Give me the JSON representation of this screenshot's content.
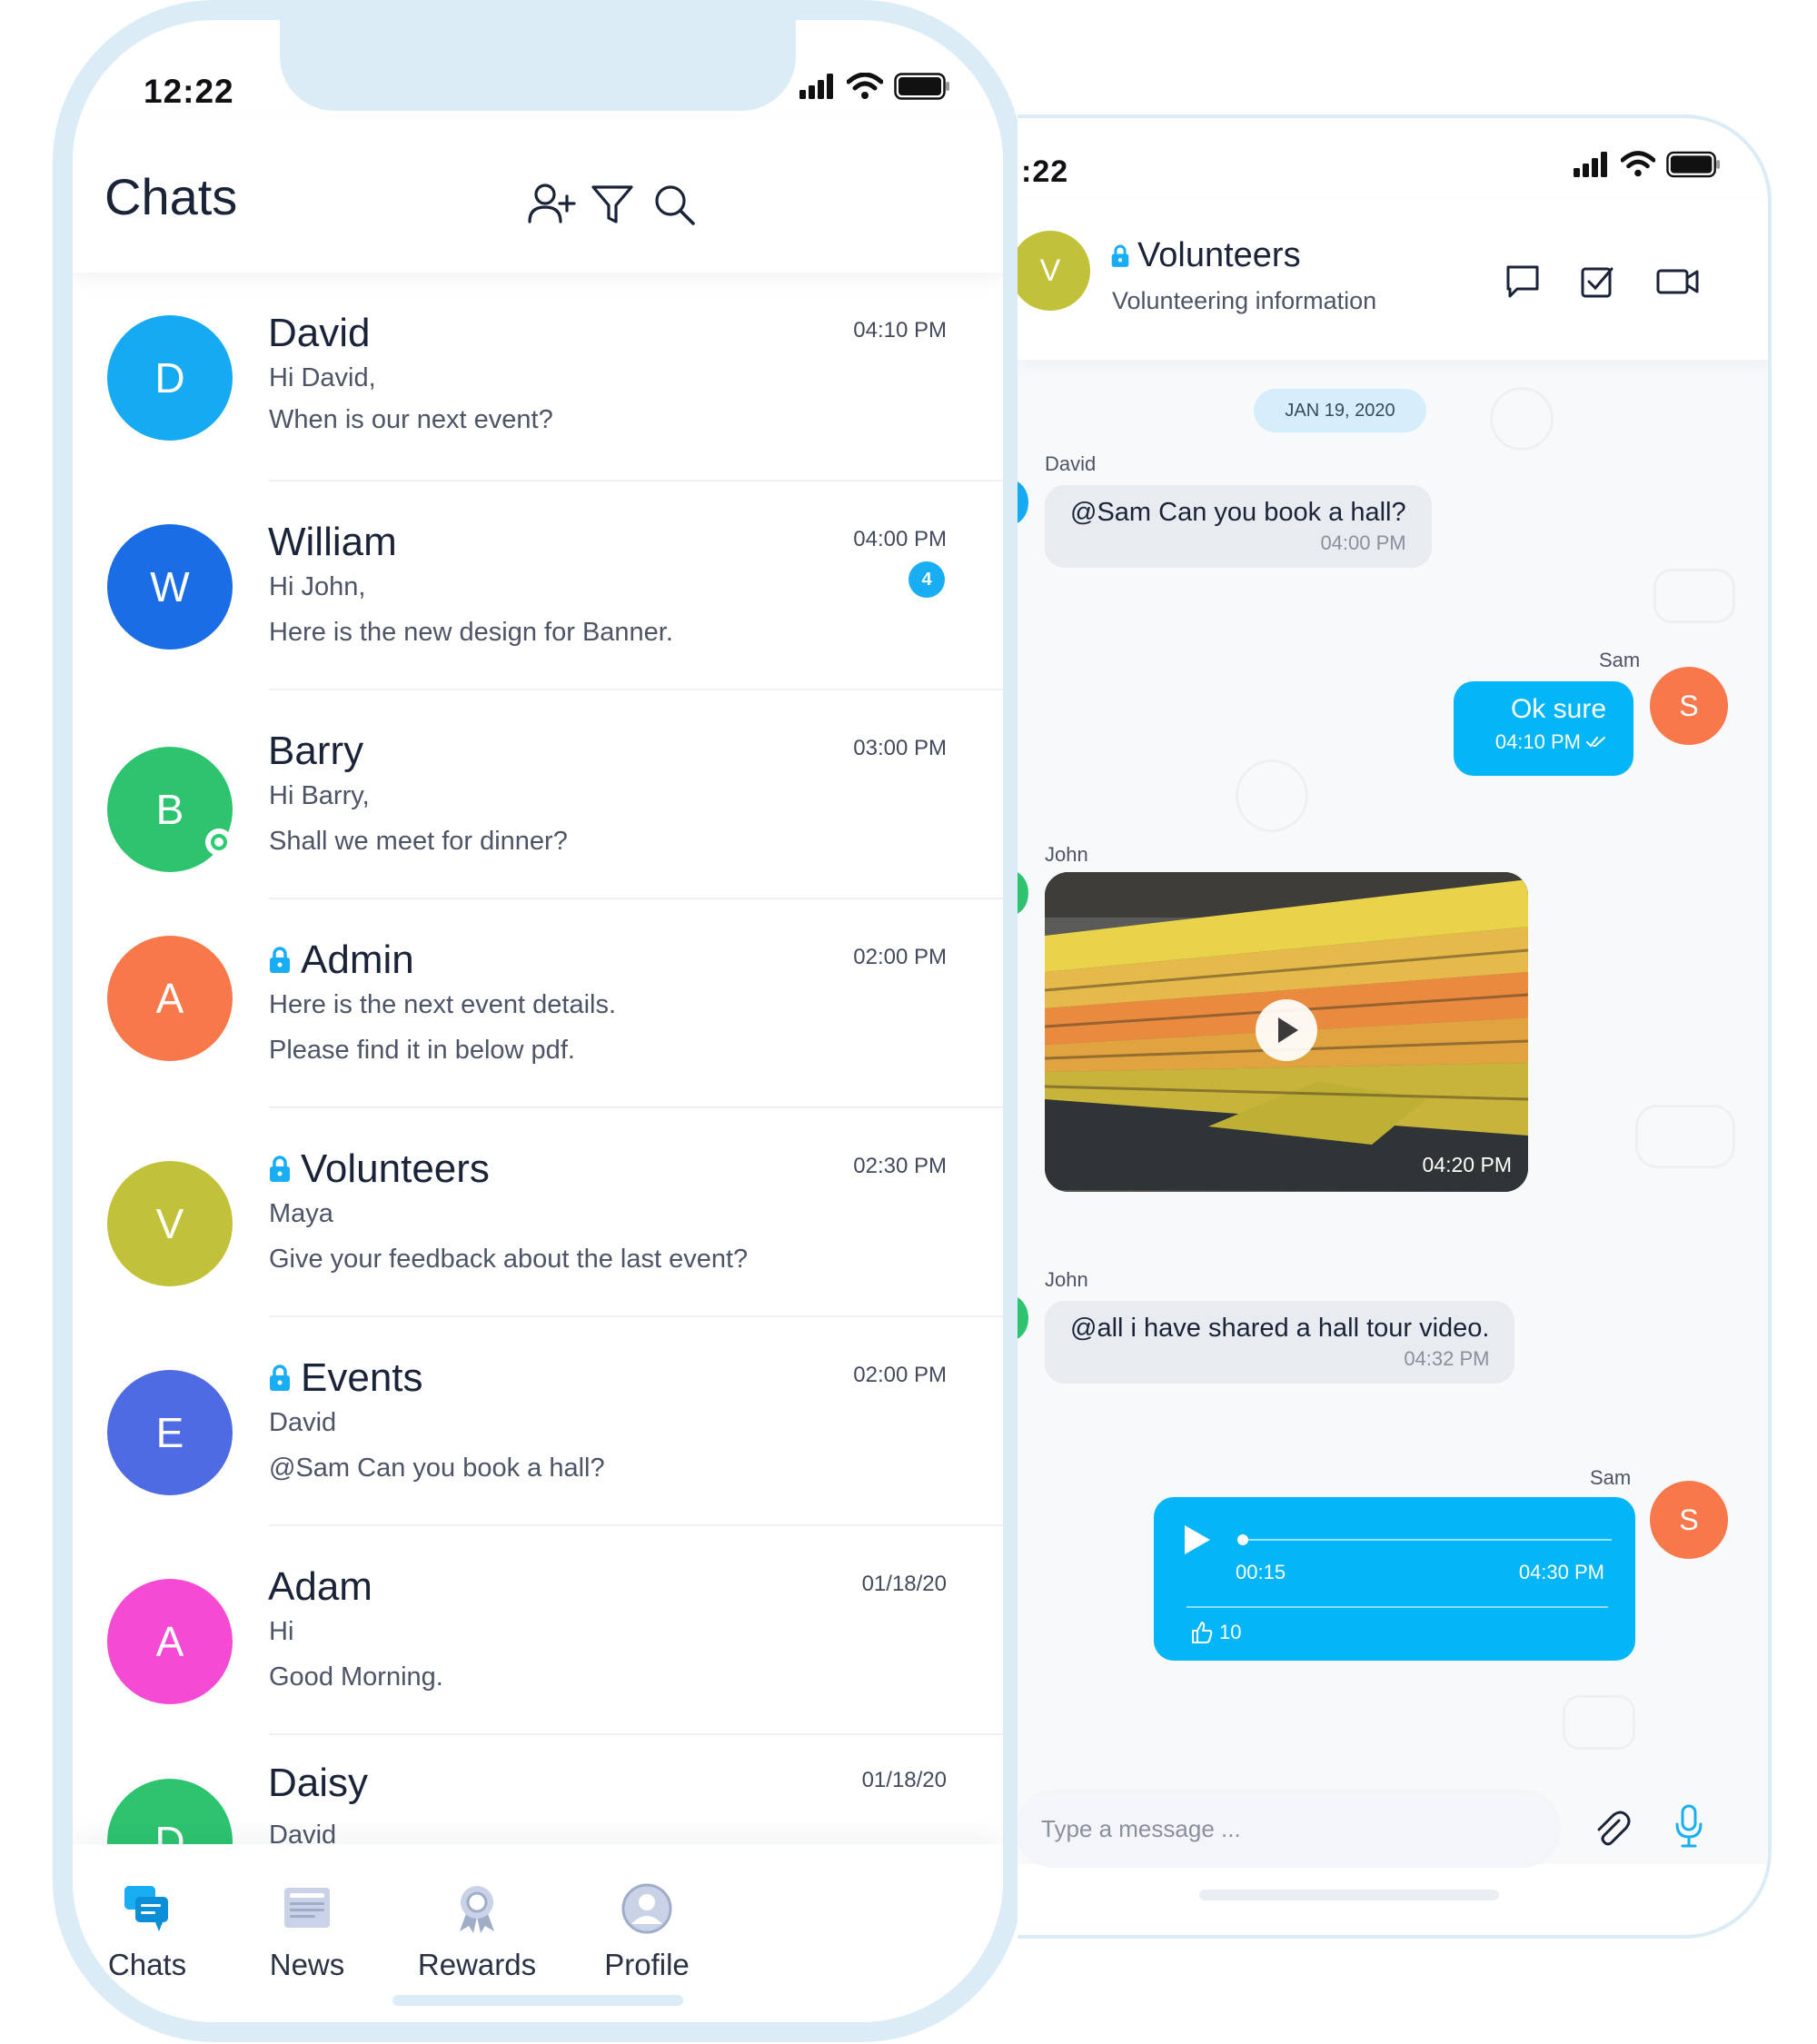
{
  "left": {
    "status_time": "12:22",
    "title": "Chats",
    "chats": [
      {
        "initial": "D",
        "name": "David",
        "time": "04:10 PM",
        "line1": "Hi David,",
        "line2": "When is our next event?",
        "color": "#16aaf2",
        "locked": false,
        "badge": null,
        "online": false
      },
      {
        "initial": "W",
        "name": "William",
        "time": "04:00 PM",
        "line1": "Hi John,",
        "line2": "Here is the new design for Banner.",
        "color": "#1a6de4",
        "locked": false,
        "badge": "4",
        "online": false
      },
      {
        "initial": "B",
        "name": "Barry",
        "time": "03:00 PM",
        "line1": "Hi Barry,",
        "line2": "Shall we meet for dinner?",
        "color": "#2ec46f",
        "locked": false,
        "badge": null,
        "online": true
      },
      {
        "initial": "A",
        "name": "Admin",
        "time": "02:00 PM",
        "line1": "Here is the next event details.",
        "line2": "Please find it in below pdf.",
        "color": "#f7784a",
        "locked": true,
        "badge": null,
        "online": false
      },
      {
        "initial": "V",
        "name": "Volunteers",
        "time": "02:30 PM",
        "line1": "Maya",
        "line2": "Give your feedback about the last event?",
        "color": "#c2c13a",
        "locked": true,
        "badge": null,
        "online": false
      },
      {
        "initial": "E",
        "name": "Events",
        "time": "02:00 PM",
        "line1": "David",
        "line2": "@Sam Can you book a hall?",
        "color": "#4e6be3",
        "locked": true,
        "badge": null,
        "online": false
      },
      {
        "initial": "A",
        "name": "Adam",
        "time": "01/18/20",
        "line1": "Hi",
        "line2": "Good Morning.",
        "color": "#f54ad4",
        "locked": false,
        "badge": null,
        "online": false
      },
      {
        "initial": "D",
        "name": "Daisy",
        "time": "01/18/20",
        "line1": "David",
        "line2": "",
        "color": "#2ec46f",
        "locked": false,
        "badge": null,
        "online": false
      }
    ],
    "tabs": [
      {
        "label": "Chats",
        "icon": "chats-icon",
        "active": true
      },
      {
        "label": "News",
        "icon": "news-icon",
        "active": false
      },
      {
        "label": "Rewards",
        "icon": "rewards-icon",
        "active": false
      },
      {
        "label": "Profile",
        "icon": "profile-icon",
        "active": false
      }
    ]
  },
  "right": {
    "status_time": ":22",
    "group": {
      "initial": "V",
      "name": "Volunteers",
      "subtitle": "Volunteering information"
    },
    "date_pill": "JAN 19, 2020",
    "messages": {
      "m1": {
        "sender": "David",
        "text": "@Sam Can you book a hall?",
        "time": "04:00 PM"
      },
      "m2": {
        "sender": "Sam",
        "text": "Ok sure",
        "time": "04:10 PM",
        "avatar": "S"
      },
      "m3": {
        "sender": "John",
        "time": "04:20 PM"
      },
      "m4": {
        "sender": "John",
        "text": "@all i have shared a hall tour video.",
        "time": "04:32 PM"
      },
      "m5": {
        "sender": "Sam",
        "elapsed": "00:15",
        "time": "04:30 PM",
        "likes": "10",
        "avatar": "S",
        "progress": 0.0
      }
    },
    "input_placeholder": "Type a message ..."
  },
  "colors": {
    "accent": "#04b6f7",
    "frame": "#dcecf7",
    "text_dark": "#1b2338"
  }
}
